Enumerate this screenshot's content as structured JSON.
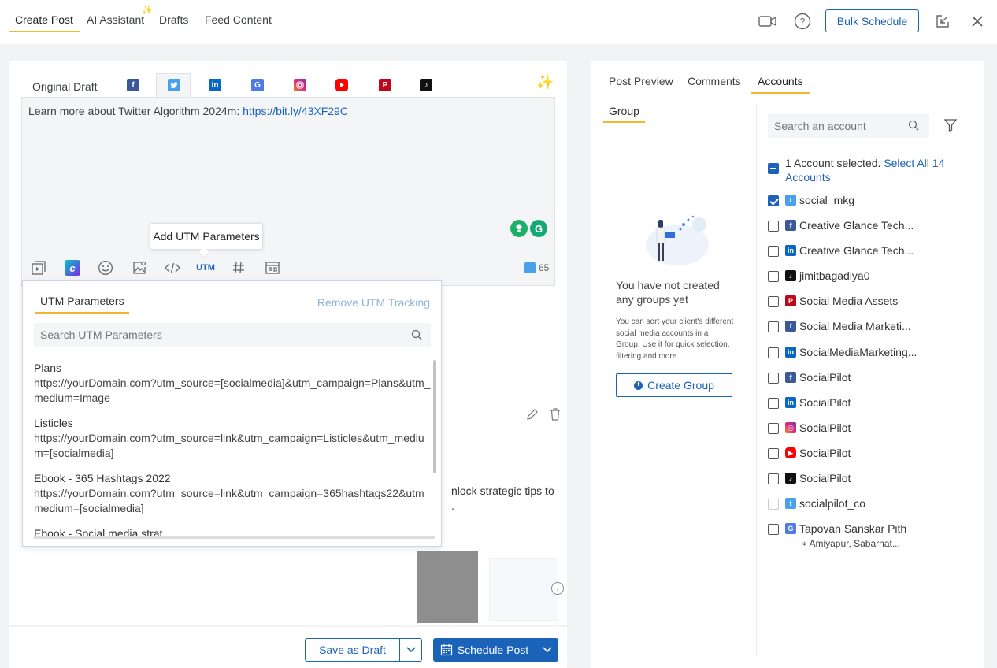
{
  "top_tabs": {
    "create_post": "Create Post",
    "ai_assistant": "AI Assistant",
    "drafts": "Drafts",
    "feed_content": "Feed Content"
  },
  "bulk_schedule": "Bulk Schedule",
  "editor": {
    "original_draft": "Original Draft",
    "text": "Learn more about Twitter Algorithm 2024m: ",
    "link": "https://bit.ly/43XF29C",
    "utm_label": "UTM",
    "char_count": "65",
    "tooltip": "Add UTM Parameters"
  },
  "utm_popup": {
    "title": "UTM Parameters",
    "remove": "Remove UTM Tracking",
    "search_placeholder": "Search UTM Parameters",
    "items": [
      {
        "name": "Plans",
        "url": "https://yourDomain.com?utm_source=[socialmedia]&utm_campaign=Plans&utm_medium=Image"
      },
      {
        "name": "Listicles",
        "url": "https://yourDomain.com?utm_source=link&utm_campaign=Listicles&utm_medium=[socialmedia]"
      },
      {
        "name": "Ebook - 365 Hashtags 2022",
        "url": "https://yourDomain.com?utm_source=link&utm_campaign=365hashtags22&utm_medium=[socialmedia]"
      },
      {
        "name": "Ebook - Social media strat",
        "url": ""
      }
    ]
  },
  "background": {
    "text_line1": "nlock strategic tips to",
    "text_line2": "."
  },
  "bottom": {
    "save_draft": "Save as Draft",
    "schedule_post": "Schedule Post"
  },
  "right_panel": {
    "tabs": {
      "preview": "Post Preview",
      "comments": "Comments",
      "accounts": "Accounts"
    },
    "group_tab": "Group",
    "empty_title": "You have not created any groups yet",
    "empty_desc": "You can sort your client's different social media accounts in a Group. Use it for quick selection, filtering and more.",
    "create_group": "Create Group",
    "search_placeholder": "Search an account",
    "selected_text": "1 Account selected.",
    "select_all": "Select All 14 Accounts",
    "accounts": [
      {
        "name": "social_mkg",
        "network": "twitter",
        "checked": true
      },
      {
        "name": "Creative Glance Tech...",
        "network": "facebook",
        "checked": false
      },
      {
        "name": "Creative Glance Tech...",
        "network": "linkedin",
        "checked": false
      },
      {
        "name": "jimitbagadiya0",
        "network": "tiktok",
        "checked": false
      },
      {
        "name": "Social Media Assets",
        "network": "pinterest",
        "checked": false
      },
      {
        "name": "Social Media Marketi...",
        "network": "facebook",
        "checked": false
      },
      {
        "name": "SocialMediaMarketing...",
        "network": "linkedin",
        "checked": false
      },
      {
        "name": "SocialPilot",
        "network": "facebook",
        "checked": false
      },
      {
        "name": "SocialPilot",
        "network": "linkedin",
        "checked": false
      },
      {
        "name": "SocialPilot",
        "network": "instagram",
        "checked": false
      },
      {
        "name": "SocialPilot",
        "network": "youtube",
        "checked": false
      },
      {
        "name": "SocialPilot",
        "network": "tiktok",
        "checked": false
      },
      {
        "name": "socialpilot_co",
        "network": "twitter",
        "checked": false
      },
      {
        "name": "Tapovan Sanskar Pith",
        "network": "google-business",
        "checked": false,
        "location": "Amiyapur, Sabarnat..."
      }
    ]
  },
  "colors": {
    "primary": "#1a63b8",
    "accent": "#f2b632"
  }
}
